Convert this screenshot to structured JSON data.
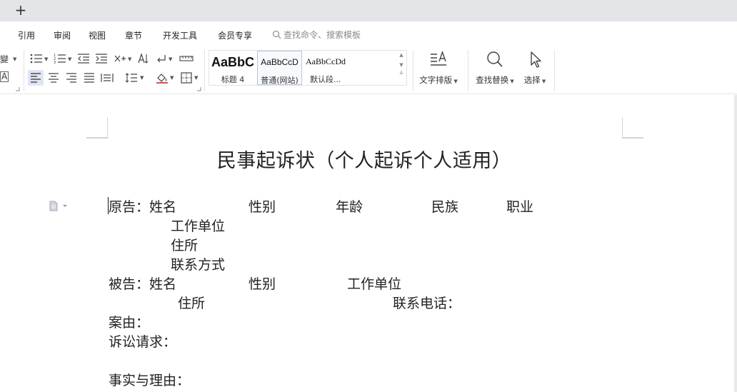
{
  "tabbar": {
    "add_label": "+"
  },
  "menu": {
    "items": [
      "引用",
      "审阅",
      "视图",
      "章节",
      "开发工具",
      "会员专享"
    ],
    "search_placeholder": "查找命令、搜索模板"
  },
  "toolbar": {
    "partial_left_top": "變",
    "partial_left_bottom": "A",
    "styles": [
      {
        "sample": "AaBbC",
        "name": "标题 4"
      },
      {
        "sample": "AaBbCcD",
        "name": "普通(网站)"
      },
      {
        "sample": "AaBbCcDd",
        "name": "默认段..."
      }
    ],
    "text_layout_label": "文字排版",
    "find_replace_label": "查找替换",
    "select_label": "选择"
  },
  "document": {
    "title": "民事起诉状（个人起诉个人适用）",
    "plaintiff": {
      "label": "原告：姓名",
      "gender": "性别",
      "age": "年龄",
      "ethnicity": "民族",
      "occupation": "职业",
      "employer": "工作单位",
      "address": "住所",
      "contact": "联系方式"
    },
    "defendant": {
      "label": "被告：姓名",
      "gender": "性别",
      "employer": "工作单位",
      "address": "住所",
      "phone": "联系电话："
    },
    "cause": "案由：",
    "claims": "诉讼请求：",
    "facts": "事实与理由："
  },
  "colors": {
    "tabbar_bg": "#e4e5e9",
    "active_button_bg": "#dfe6f3",
    "text": "#222222"
  }
}
